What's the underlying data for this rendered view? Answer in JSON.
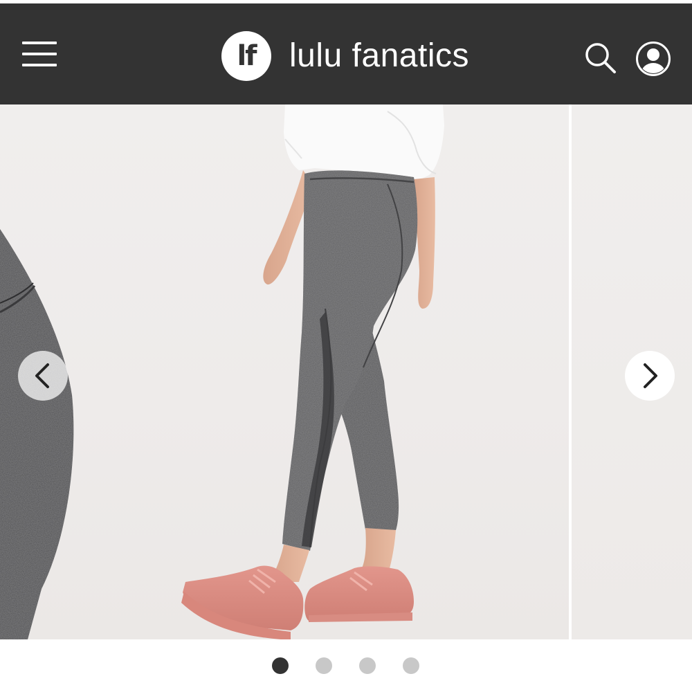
{
  "header": {
    "brand_logo_text": "lf",
    "brand_name": "lulu fanatics",
    "menu_icon": "hamburger-menu-icon",
    "search_icon": "search-icon",
    "account_icon": "user-account-icon",
    "background_color": "#333333"
  },
  "carousel": {
    "prev_icon": "chevron-left-icon",
    "next_icon": "chevron-right-icon",
    "image_subject": "gray heathered high-rise leggings with mesh panel and pink sneakers",
    "slide_count": 4,
    "active_index": 0
  },
  "pagination": {
    "dots": [
      {
        "active": true,
        "color": "#333333"
      },
      {
        "active": false,
        "color": "#c8c8c8"
      },
      {
        "active": false,
        "color": "#c8c8c8"
      },
      {
        "active": false,
        "color": "#c8c8c8"
      }
    ]
  }
}
